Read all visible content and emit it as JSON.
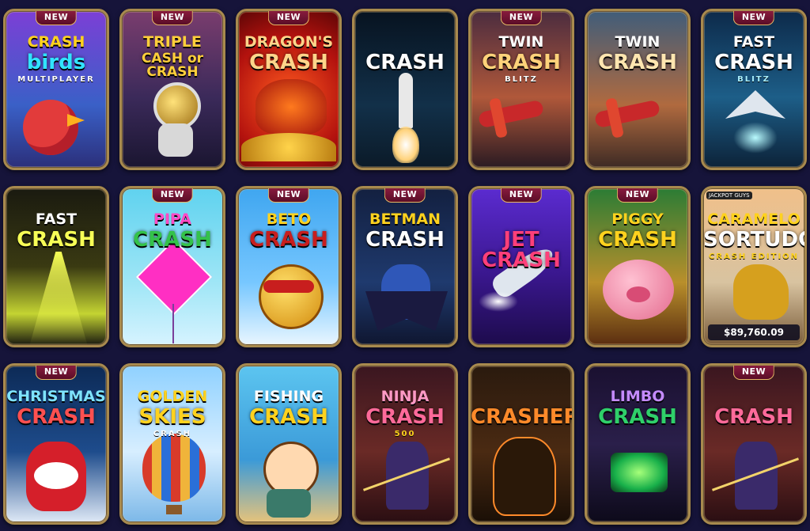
{
  "badge_label": "NEW",
  "rows": [
    [
      {
        "t1": "CRASH",
        "t2": "birds",
        "t3": "MULTIPLAYER",
        "new": true
      },
      {
        "t1": "TRIPLE",
        "t2": "CASH or CRASH",
        "t3": "",
        "new": true
      },
      {
        "t1": "DRAGON'S",
        "t2": "CRASH",
        "t3": "",
        "new": true
      },
      {
        "t1": "",
        "t2": "CRASH",
        "t3": "",
        "new": false
      },
      {
        "t1": "TWIN",
        "t2": "CRASH",
        "t3": "BLITZ",
        "new": true
      },
      {
        "t1": "TWIN",
        "t2": "CRASH",
        "t3": "",
        "new": false
      },
      {
        "t1": "FAST",
        "t2": "CRASH",
        "t3": "BLITZ",
        "new": true
      }
    ],
    [
      {
        "t1": "FAST",
        "t2": "CRASH",
        "t3": "",
        "new": false
      },
      {
        "t1": "PIPA",
        "t2": "CRASH",
        "t3": "",
        "new": true
      },
      {
        "t1": "BETO",
        "t2": "CRASH",
        "t3": "",
        "new": true
      },
      {
        "t1": "BETMAN",
        "t2": "CRASH",
        "t3": "",
        "new": true
      },
      {
        "t1": "",
        "t2": "JET CRASH",
        "t3": "",
        "new": true
      },
      {
        "t1": "PIGGY",
        "t2": "CRASH",
        "t3": "",
        "new": true
      },
      {
        "t1": "CARAMELO",
        "t2": "SORTUDO",
        "t3": "CRASH EDITION",
        "new": false,
        "jackpot": "$89,760.09",
        "chip": "JACKPOT GUYS"
      }
    ],
    [
      {
        "t1": "CHRISTMAS",
        "t2": "CRASH",
        "t3": "",
        "new": true
      },
      {
        "t1": "GOLDEN",
        "t2": "SKIES",
        "t3": "CRASH",
        "new": false
      },
      {
        "t1": "FISHING",
        "t2": "CRASH",
        "t3": "",
        "new": false
      },
      {
        "t1": "NINJA",
        "t2": "CRASH",
        "t3": "500",
        "new": false
      },
      {
        "t1": "",
        "t2": "CRASHER",
        "t3": "",
        "new": false
      },
      {
        "t1": "LIMBO",
        "t2": "CRASH",
        "t3": "",
        "new": false
      },
      {
        "t1": "",
        "t2": "CRASH",
        "t3": "",
        "new": true
      }
    ]
  ]
}
